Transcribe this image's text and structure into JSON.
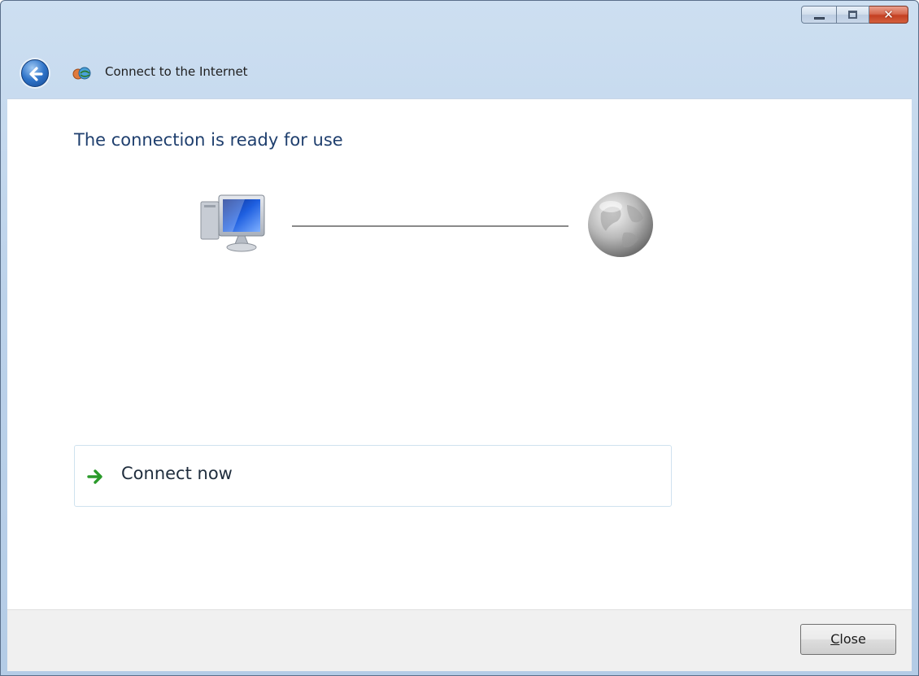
{
  "window": {
    "title": "Connect to the Internet",
    "caption_buttons": {
      "minimize_icon": "minimize-icon",
      "maximize_icon": "maximize-icon",
      "close_icon": "close-icon",
      "close_glyph": "✕"
    }
  },
  "header": {
    "back_icon": "back-arrow-icon",
    "app_icon": "network-icon"
  },
  "main": {
    "heading": "The connection is ready for use",
    "diagram": {
      "left_icon": "computer-icon",
      "right_icon": "internet-globe-icon"
    },
    "commands": [
      {
        "label": "Connect now",
        "icon": "green-arrow-icon"
      }
    ]
  },
  "footer": {
    "close_button": {
      "mnemonic": "C",
      "rest": "lose"
    }
  },
  "colors": {
    "heading": "#1f3f6e",
    "titlebar": "#bcd2ea",
    "close_button_red": "#c43f22",
    "command_border": "#cfe2ef",
    "arrow_green": "#2a9a2a"
  }
}
